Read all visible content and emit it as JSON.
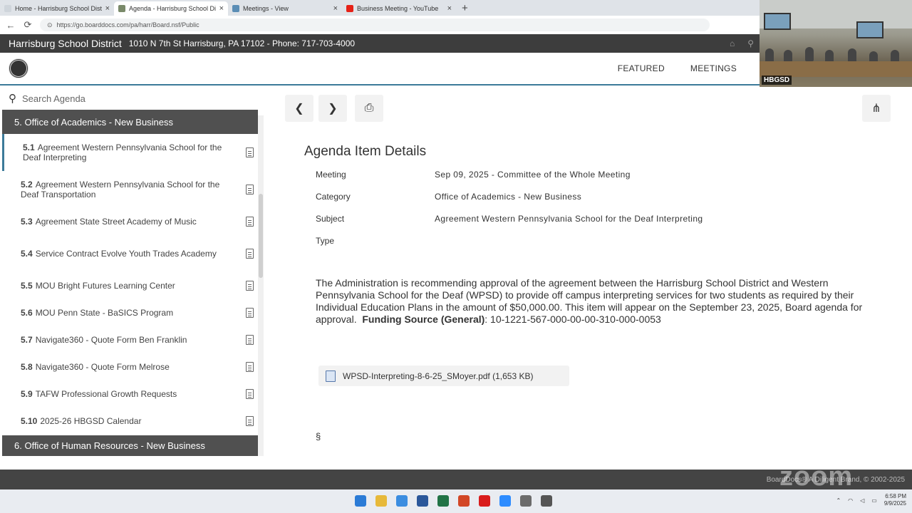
{
  "browser": {
    "tabs": [
      {
        "title": "Home - Harrisburg School District",
        "favicon_color": "#cfd5db",
        "active": false
      },
      {
        "title": "Agenda - Harrisburg School District",
        "favicon_color": "#7a8a6a",
        "active": true
      },
      {
        "title": "Meetings - View",
        "favicon_color": "#5b8db5",
        "active": false
      },
      {
        "title": "Business Meeting - YouTube",
        "favicon_color": "#e62117",
        "active": false
      }
    ],
    "url": "https://go.boarddocs.com/pa/harr/Board.nsf/Public"
  },
  "site": {
    "district": "Harrisburg School District",
    "address": "1010 N 7th St Harrisburg, PA 17102 - Phone: 717-703-4000",
    "nav": [
      "FEATURED",
      "MEETINGS"
    ]
  },
  "video": {
    "label": "HBGSD"
  },
  "sidebar": {
    "search_placeholder": "Search Agenda",
    "section_header": "5. Office of Academics - New Business",
    "items": [
      {
        "num": "5.1",
        "title": "Agreement Western Pennsylvania School for the Deaf Interpreting"
      },
      {
        "num": "5.2",
        "title": "Agreement Western Pennsylvania School for the Deaf Transportation"
      },
      {
        "num": "5.3",
        "title": "Agreement State Street Academy of Music"
      },
      {
        "num": "5.4",
        "title": "Service Contract Evolve Youth Trades Academy"
      },
      {
        "num": "5.5",
        "title": "MOU Bright Futures Learning Center"
      },
      {
        "num": "5.6",
        "title": "MOU Penn State - BaSICS Program"
      },
      {
        "num": "5.7",
        "title": "Navigate360 - Quote Form Ben Franklin"
      },
      {
        "num": "5.8",
        "title": "Navigate360 - Quote Form Melrose"
      },
      {
        "num": "5.9",
        "title": "TAFW Professional Growth Requests"
      },
      {
        "num": "5.10",
        "title": "2025-26 HBGSD Calendar"
      }
    ],
    "next_section": "6. Office of Human Resources - New Business"
  },
  "details": {
    "title": "Agenda Item Details",
    "meeting_label": "Meeting",
    "meeting_value": "Sep 09, 2025 - Committee of the Whole Meeting",
    "category_label": "Category",
    "category_value": "Office of Academics - New Business",
    "subject_label": "Subject",
    "subject_value": "Agreement Western Pennsylvania School for the Deaf Interpreting",
    "type_label": "Type",
    "description": "The Administration is recommending approval of the agreement between the Harrisburg School District and Western Pennsylvania School for the Deaf (WPSD) to provide off campus interpreting services for two students as required by their Individual Education Plans in the amount of $50,000.00. This item will appear on the September 23, 2025, Board agenda for approval.",
    "funding_label": "Funding Source (General)",
    "funding_value": ": 10-1221-567-000-00-00-310-000-0053",
    "attachment": "WPSD-Interpreting-8-6-25_SMoyer.pdf (1,653 KB)",
    "section_mark": "§"
  },
  "footer": {
    "text": "BoardDocs® A Diligent Brand, © 2002-2025",
    "zoom_watermark": "zoom"
  },
  "taskbar": {
    "apps": [
      {
        "name": "windows-start",
        "color": "#2b7bd6"
      },
      {
        "name": "file-explorer",
        "color": "#e7b93a"
      },
      {
        "name": "chrome",
        "color": "#3b8de0"
      },
      {
        "name": "word",
        "color": "#2b579a"
      },
      {
        "name": "excel",
        "color": "#217346"
      },
      {
        "name": "powerpoint",
        "color": "#d24726"
      },
      {
        "name": "acrobat",
        "color": "#d91c1c"
      },
      {
        "name": "zoom",
        "color": "#2d8cff"
      },
      {
        "name": "settings",
        "color": "#6b6b6b"
      },
      {
        "name": "store",
        "color": "#555555"
      }
    ],
    "time": "6:58 PM",
    "date": "9/9/2025"
  }
}
